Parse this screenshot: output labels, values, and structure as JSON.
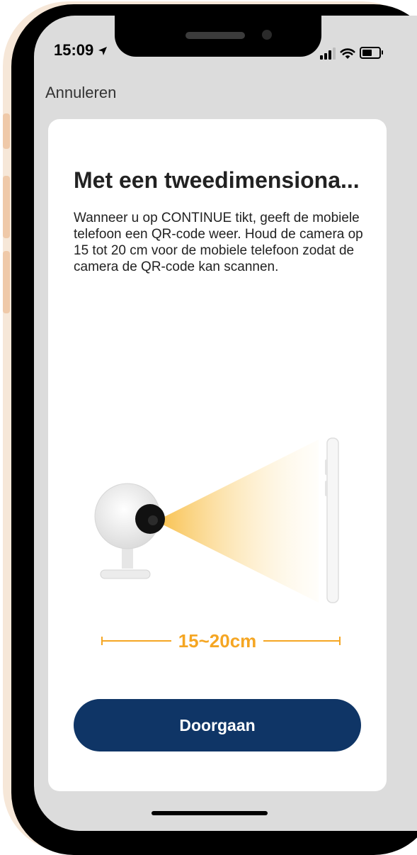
{
  "status_bar": {
    "time": "15:09",
    "location_icon": "location-arrow-icon",
    "signal_icon": "signal-icon",
    "wifi_icon": "wifi-icon",
    "battery_icon": "battery-icon"
  },
  "nav": {
    "cancel_label": "Annuleren"
  },
  "content": {
    "title": "Met een tweedimensiona...",
    "description": "Wanneer u op CONTINUE tikt, geeft de mobiele telefoon een QR-code weer. Houd de camera op 15 tot 20 cm voor de mobiele telefoon zodat de camera de QR-code kan scannen.",
    "distance_label": "15~20cm"
  },
  "actions": {
    "continue_label": "Doorgaan"
  },
  "colors": {
    "accent": "#f5a623",
    "button": "#0f3566",
    "background": "#dcdcdc",
    "card": "#ffffff"
  }
}
